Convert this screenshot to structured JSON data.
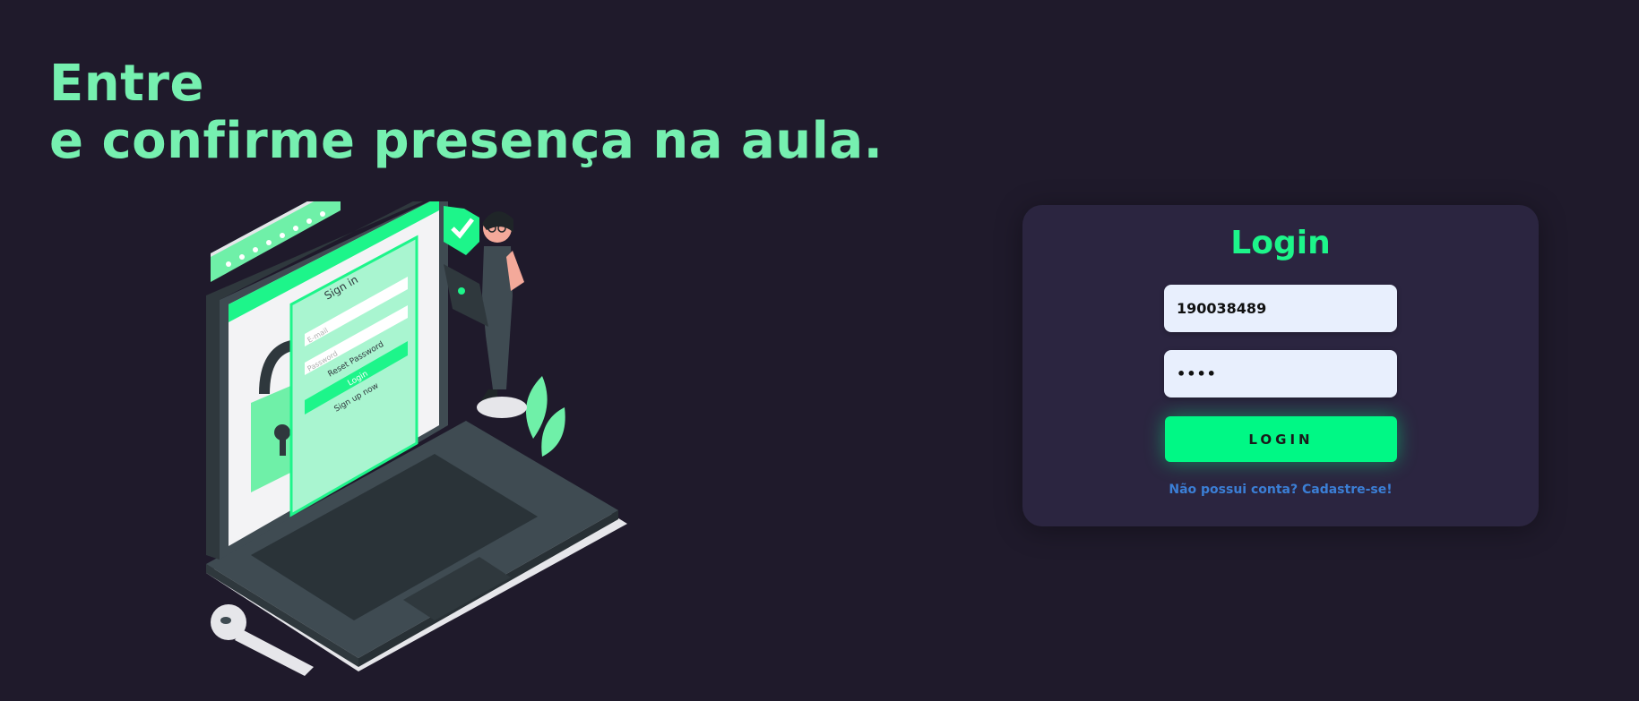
{
  "headline": {
    "line1": "Entre",
    "line2": "e confirme presença na aula."
  },
  "illustration": {
    "browser_signin_title": "Sign in",
    "email_placeholder": "E-mail",
    "password_placeholder": "Password",
    "reset_password": "Reset Password",
    "login": "Login",
    "sign_up": "Sign up now"
  },
  "login_card": {
    "title": "Login",
    "username_value": "190038489",
    "password_value": "••••",
    "login_button": "LOGIN",
    "signup_link": "Não possui conta? Cadastre-se!"
  },
  "colors": {
    "background": "#1f1a2b",
    "card": "#2b2540",
    "accent": "#1df58a",
    "headline": "#76f0b0",
    "link": "#3b7fd6"
  }
}
